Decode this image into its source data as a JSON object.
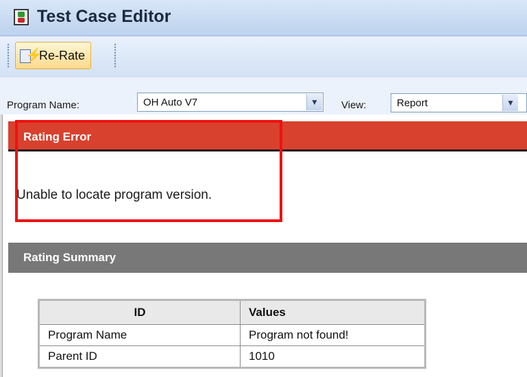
{
  "window": {
    "title": "Test Case Editor",
    "icon": "traffic-light-icon"
  },
  "toolbar": {
    "rerate_label": "Re-Rate",
    "rerate_icon": "rerate-lightning-icon"
  },
  "filters": {
    "program_label": "Program Name:",
    "program_value": "OH Auto V7",
    "view_label": "View:",
    "view_value": "Report"
  },
  "error_section": {
    "heading": "Rating Error",
    "message": "Unable to locate program version."
  },
  "summary_section": {
    "heading": "Rating Summary",
    "columns": [
      "ID",
      "Values"
    ],
    "rows": [
      [
        "Program Name",
        "Program not found!"
      ],
      [
        "Parent ID",
        "1010"
      ]
    ]
  },
  "colors": {
    "error_header": "#d8412e",
    "summary_header": "#787878",
    "highlight_box": "#ee1111"
  }
}
